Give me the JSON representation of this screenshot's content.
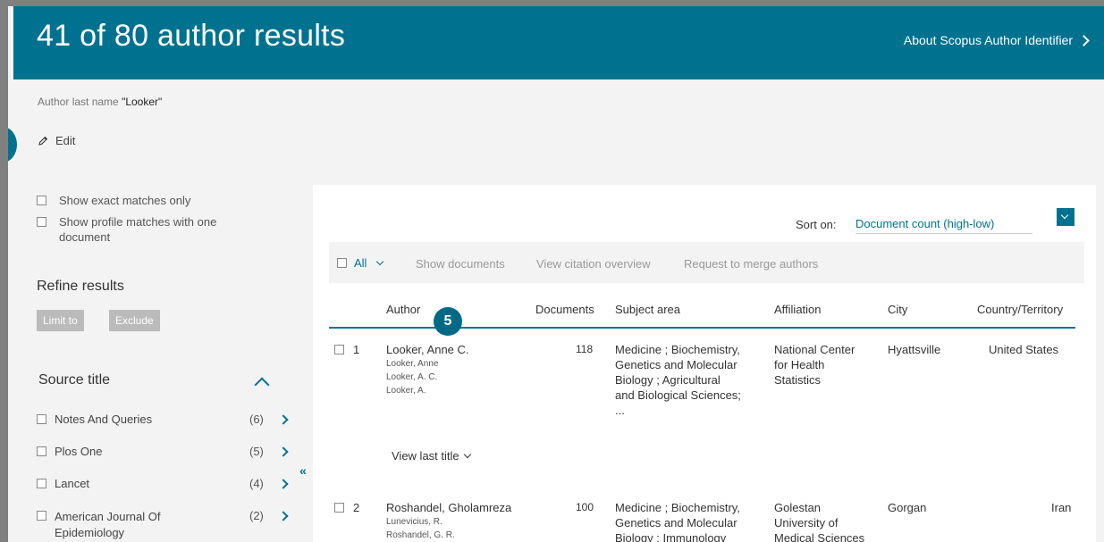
{
  "header": {
    "title": "41 of 80 author results",
    "about_link": "About Scopus Author Identifier"
  },
  "query": {
    "label": "Author last name",
    "value": "\"Looker\"",
    "edit_label": "Edit"
  },
  "sidebar": {
    "exact_matches": "Show exact matches only",
    "profile_matches_line1": "Show profile matches with one",
    "profile_matches_line2": "document",
    "refine_title": "Refine results",
    "limit_to": "Limit to",
    "exclude": "Exclude",
    "source_title": "Source title",
    "sources": [
      {
        "name": "Notes And Queries",
        "count": "(6)"
      },
      {
        "name": "Plos One",
        "count": "(5)"
      },
      {
        "name": "Lancet",
        "count": "(4)"
      },
      {
        "name_line1": "American Journal Of",
        "name_line2": "Epidemiology",
        "count": "(2)"
      }
    ]
  },
  "sort": {
    "label": "Sort on:",
    "value": "Document count (high-low)"
  },
  "toolbar": {
    "all": "All",
    "show_documents": "Show documents",
    "view_citation": "View citation overview",
    "merge": "Request to merge authors"
  },
  "columns": {
    "author": "Author",
    "documents": "Documents",
    "subject": "Subject area",
    "affiliation": "Affiliation",
    "city": "City",
    "country": "Country/Territory"
  },
  "step_badge": "5",
  "rows": [
    {
      "num": "1",
      "author": "Looker, Anne C.",
      "variants": [
        "Looker, Anne",
        "Looker, A. C.",
        "Looker, A."
      ],
      "documents": "118",
      "subject": [
        "Medicine ; Biochemistry,",
        "Genetics and Molecular",
        "Biology ; Agricultural",
        "and Biological Sciences;",
        "..."
      ],
      "affiliation": [
        "National Center",
        "for Health",
        "Statistics"
      ],
      "city": "Hyattsville",
      "country": "United States",
      "view_last": "View last title"
    },
    {
      "num": "2",
      "author": "Roshandel, Gholamreza",
      "variants": [
        "Lunevicius, R.",
        "Roshandel, G. R."
      ],
      "documents": "100",
      "subject": [
        "Medicine ; Biochemistry,",
        "Genetics and Molecular",
        "Biology ; Immunology"
      ],
      "affiliation": [
        "Golestan",
        "University of",
        "Medical Sciences"
      ],
      "city": "Gorgan",
      "country": "Iran"
    }
  ]
}
